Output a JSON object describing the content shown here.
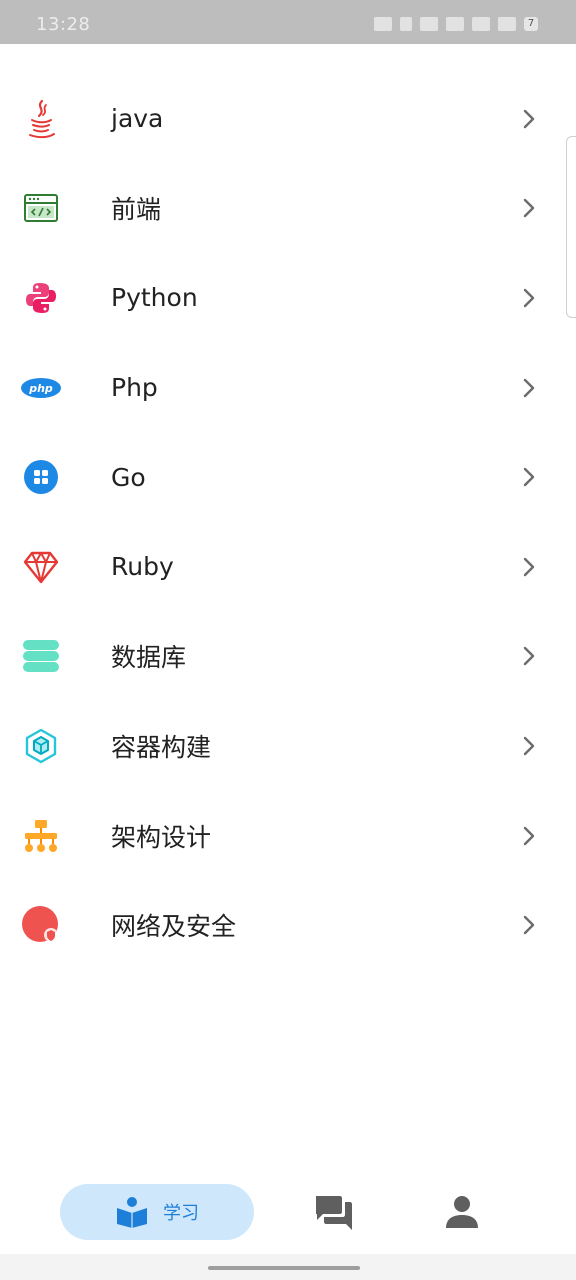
{
  "status_bar": {
    "time": "13:28",
    "badge": "7"
  },
  "menu": {
    "items": [
      {
        "label": "java",
        "icon": "java-icon"
      },
      {
        "label": "前端",
        "icon": "frontend-code-icon"
      },
      {
        "label": "Python",
        "icon": "python-icon"
      },
      {
        "label": "Php",
        "icon": "php-icon"
      },
      {
        "label": "Go",
        "icon": "go-icon"
      },
      {
        "label": "Ruby",
        "icon": "ruby-gem-icon"
      },
      {
        "label": "数据库",
        "icon": "database-icon"
      },
      {
        "label": "容器构建",
        "icon": "container-cube-icon"
      },
      {
        "label": "架构设计",
        "icon": "architecture-tree-icon"
      },
      {
        "label": "网络及安全",
        "icon": "network-security-icon"
      }
    ]
  },
  "bottom_nav": {
    "learn_label": "学习",
    "active_color": "#1e7fd8"
  }
}
